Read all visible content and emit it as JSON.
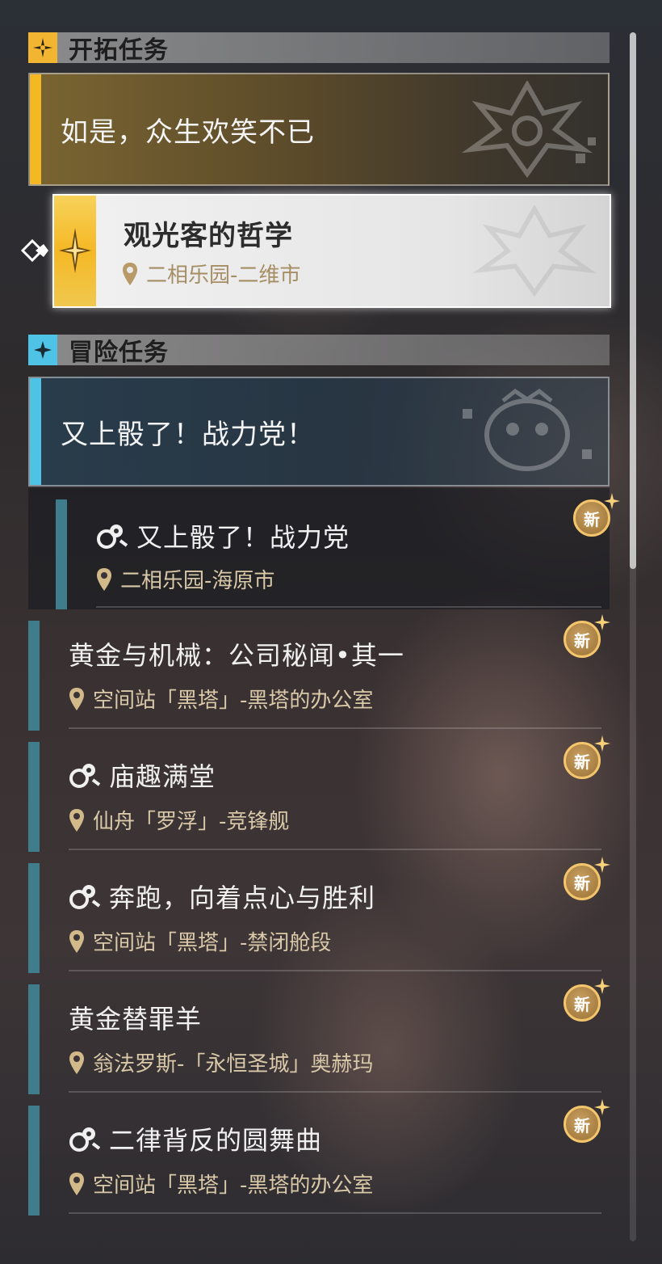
{
  "sections": {
    "trailblaze": {
      "title": "开拓任务",
      "icon": "trailblaze-icon"
    },
    "adventure": {
      "title": "冒险任务",
      "icon": "adventure-icon"
    }
  },
  "trailblaze_category": {
    "title": "如是，众生欢笑不已"
  },
  "selected_quest": {
    "title": "观光客的哲学",
    "location": "二相乐园-二维市"
  },
  "adventure_category": {
    "title": "又上骰了！战力党！"
  },
  "quests": [
    {
      "title": "又上骰了！战力党",
      "location": "二相乐园-海原市",
      "badge": "新"
    },
    {
      "title": "黄金与机械：公司秘闻•其一",
      "location": "空间站「黑塔」-黑塔的办公室",
      "badge": "新"
    },
    {
      "title": "庙趣满堂",
      "location": "仙舟「罗浮」-竞锋舰",
      "badge": "新"
    },
    {
      "title": "奔跑，向着点心与胜利",
      "location": "空间站「黑塔」-禁闭舱段",
      "badge": "新"
    },
    {
      "title": "黄金替罪羊",
      "location": "翁法罗斯-「永恒圣城」奥赫玛",
      "badge": "新"
    },
    {
      "title": "二律背反的圆舞曲",
      "location": "空间站「黑塔」-黑塔的办公室",
      "badge": "新"
    }
  ],
  "colors": {
    "gold_accent": "#f5b825",
    "blue_accent": "#4fc3e6",
    "quest_stripe": "#3f7c8c"
  }
}
